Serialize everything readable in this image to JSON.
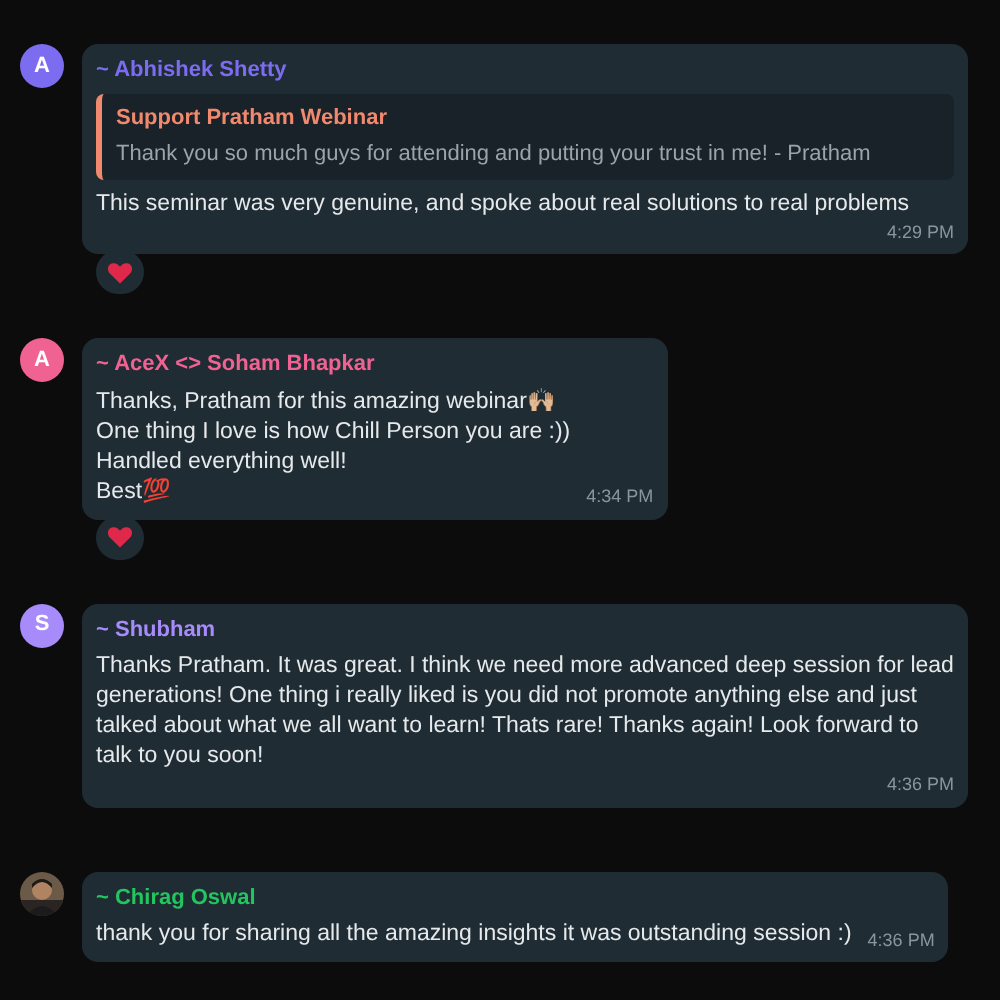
{
  "messages": [
    {
      "avatar": {
        "kind": "letter",
        "letter": "A",
        "color": "#7c6cf0"
      },
      "sender": "~ Abhishek Shetty",
      "color": "#7c6cf0",
      "quote": {
        "title": "Support Pratham Webinar",
        "text": "Thank you so much guys for attending and putting your trust in me! - Pratham"
      },
      "lines": [
        "This seminar was very genuine, and spoke about real solutions to real problems"
      ],
      "time": "4:29 PM",
      "reactions": [
        {
          "kind": "heart"
        }
      ]
    },
    {
      "avatar": {
        "kind": "letter",
        "letter": "A",
        "color": "#f06292"
      },
      "sender": "~ AceX <> Soham Bhapkar",
      "color": "#f06292",
      "lines": [
        "Thanks, Pratham for this amazing webinar🙌🏼",
        "One thing I love is how Chill Person you are :))",
        "Handled everything well!",
        "Best💯"
      ],
      "time": "4:34 PM",
      "reactions": [
        {
          "kind": "heart"
        }
      ]
    },
    {
      "avatar": {
        "kind": "letter",
        "letter": "S",
        "color": "#a78bfa"
      },
      "sender": "~ Shubham",
      "color": "#a78bfa",
      "lines": [
        "Thanks Pratham. It was great. I think we need more advanced deep session for lead generations! One thing i really liked is you did not promote anything else and just talked about what we all want to learn!  Thats rare! Thanks again! Look forward to talk to you soon!"
      ],
      "time": "4:36 PM"
    },
    {
      "sender": "~ Chirag Oswal",
      "color": "#22c55e",
      "lines": [
        "thank you for sharing all the amazing insights it was outstanding session :)"
      ],
      "time": "4:36 PM"
    }
  ]
}
